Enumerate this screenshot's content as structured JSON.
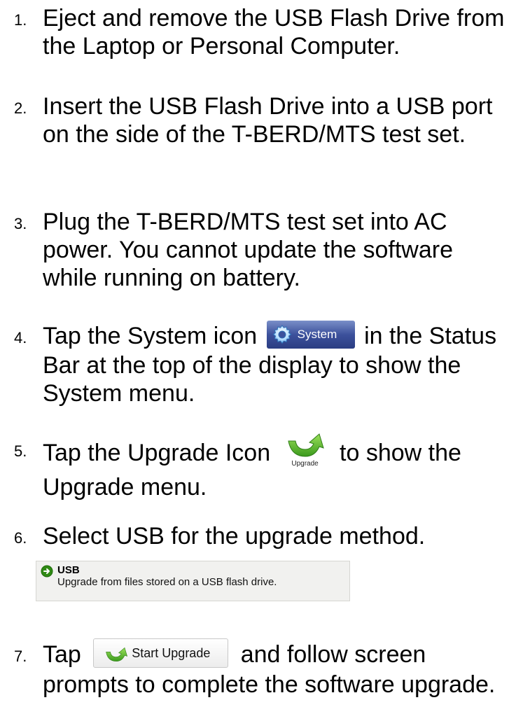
{
  "steps": [
    {
      "number": "1.",
      "text": "Eject and remove the USB Flash Drive from the Laptop or Personal Computer."
    },
    {
      "number": "2.",
      "text": "Insert the USB Flash Drive into a USB port on the side of the T-BERD/MTS test set."
    },
    {
      "number": "3.",
      "text": "Plug the T-BERD/MTS test set into AC power.  You cannot update the software while running on battery."
    },
    {
      "number": "4.",
      "text_before": "Tap the System icon",
      "text_after": "in the Status Bar at the top of the display to show the System menu."
    },
    {
      "number": "5.",
      "text_before": "Tap the Upgrade Icon",
      "text_after": "to show the Upgrade menu."
    },
    {
      "number": "6.",
      "text": "Select USB for the upgrade method."
    },
    {
      "number": "7.",
      "text_before": "Tap",
      "text_after": "and follow screen prompts to complete the software upgrade."
    }
  ],
  "system_button": {
    "label": "System",
    "icon": "gear-icon",
    "bg_color": "#3c519c"
  },
  "upgrade_icon": {
    "label": "Upgrade",
    "icon": "upgrade-arrow-icon",
    "color": "#4caf2a"
  },
  "usb_option": {
    "title": "USB",
    "description": "Upgrade from files stored on a USB flash drive.",
    "icon": "arrow-right-circle-icon"
  },
  "start_upgrade_button": {
    "label": "Start Upgrade",
    "icon": "upgrade-arrow-icon"
  }
}
